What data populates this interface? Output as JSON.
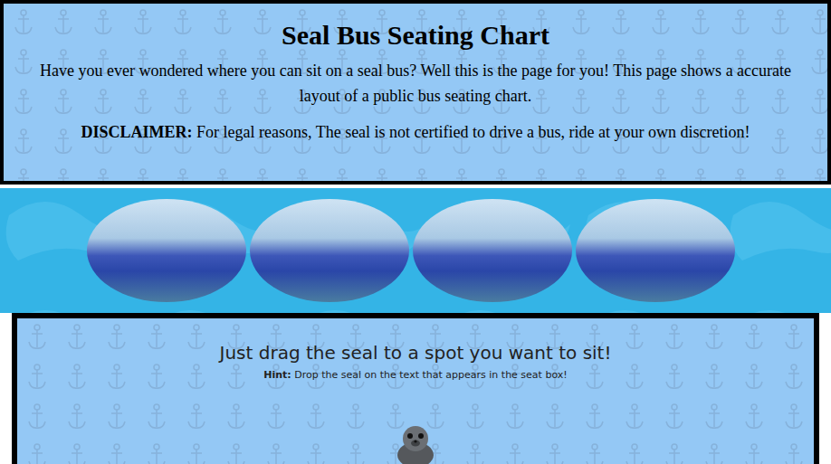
{
  "header": {
    "title": "Seal Bus Seating Chart",
    "intro": "Have you ever wondered where you can sit on a seal bus? Well this is the page for you! This page shows a accurate layout of a public bus seating chart.",
    "disclaimer_label": "DISCLAIMER:",
    "disclaimer_text": " For legal reasons, The seal is not certified to drive a bus, ride at your own discretion!"
  },
  "gallery": {
    "photos": [
      {
        "kind": "photo"
      },
      {
        "kind": "photo"
      },
      {
        "kind": "photo"
      },
      {
        "kind": "photo"
      }
    ]
  },
  "seating": {
    "title": "Just drag the seal to a spot you want to sit!",
    "hint_label": "Hint:",
    "hint_text": " Drop the seal on the text that appears in the seat box!"
  }
}
